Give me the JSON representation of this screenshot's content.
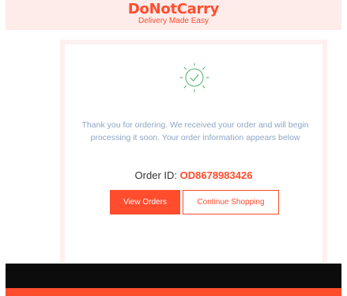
{
  "brand": {
    "name": "DoNotCarry",
    "tagline": "Delivery Made Easy"
  },
  "confirmation": {
    "icon": "check-circle-icon",
    "message": "Thank you for ordering. We received your order and will begin processing it soon. Your order information appears below",
    "order_id_label": "Order ID:",
    "order_id_value": "OD8678983426"
  },
  "actions": {
    "view_orders_label": "View Orders",
    "continue_shopping_label": "Continue Shopping"
  },
  "colors": {
    "accent": "#ff4d2e",
    "success": "#4caf6e",
    "header_bg": "#fdecea",
    "footer_dark": "#0c0c0c"
  }
}
